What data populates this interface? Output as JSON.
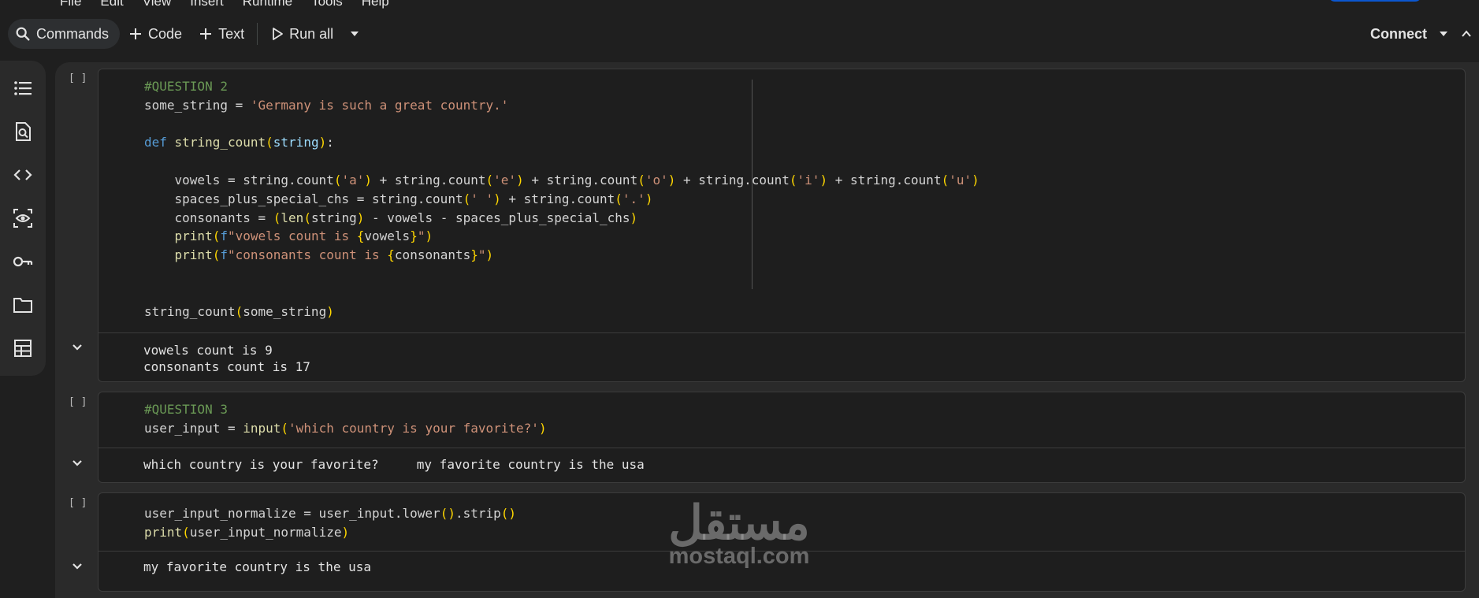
{
  "menu": {
    "items": [
      "File",
      "Edit",
      "View",
      "Insert",
      "Runtime",
      "Tools",
      "Help"
    ]
  },
  "toolbar": {
    "commands_label": "Commands",
    "code_label": "Code",
    "text_label": "Text",
    "run_all_label": "Run all",
    "connect_label": "Connect"
  },
  "sidebar": {
    "icons": [
      "table-of-contents-icon",
      "find-icon",
      "code-snippets-icon",
      "variables-inspector-icon",
      "secrets-key-icon",
      "files-folder-icon",
      "data-table-icon"
    ]
  },
  "cells": {
    "bracket": "[ ]",
    "c1": {
      "outputs": [
        "vowels count is 9",
        "consonants count is 17"
      ]
    },
    "c2": {
      "output": "which country is your favorite?     my favorite country is the usa"
    },
    "c3": {
      "output": "my favorite country is the usa"
    }
  },
  "watermark": {
    "arabic": "مستقل",
    "latin": "mostaql.com"
  },
  "colors": {
    "keyword": "#569cd6",
    "function": "#dcdcaa",
    "string": "#ce9178",
    "comment": "#6a9955",
    "bracket": "#ffd700",
    "background": "#1f1f1f"
  }
}
